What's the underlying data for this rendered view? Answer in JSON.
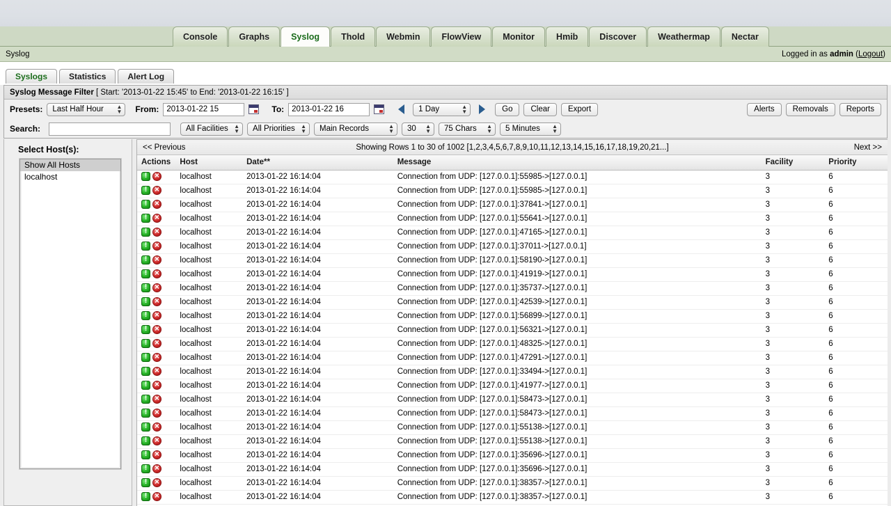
{
  "main_tabs": [
    {
      "label": "Console",
      "active": false
    },
    {
      "label": "Graphs",
      "active": false
    },
    {
      "label": "Syslog",
      "active": true
    },
    {
      "label": "Thold",
      "active": false
    },
    {
      "label": "Webmin",
      "active": false
    },
    {
      "label": "FlowView",
      "active": false
    },
    {
      "label": "Monitor",
      "active": false
    },
    {
      "label": "Hmib",
      "active": false
    },
    {
      "label": "Discover",
      "active": false
    },
    {
      "label": "Weathermap",
      "active": false
    },
    {
      "label": "Nectar",
      "active": false
    }
  ],
  "infobar": {
    "breadcrumb": "Syslog",
    "login_prefix": "Logged in as ",
    "login_user": "admin",
    "logout_open": " (",
    "logout_label": "Logout",
    "logout_close": ")"
  },
  "sub_tabs": [
    {
      "label": "Syslogs",
      "active": true
    },
    {
      "label": "Statistics",
      "active": false
    },
    {
      "label": "Alert Log",
      "active": false
    }
  ],
  "filter": {
    "title": "Syslog Message Filter",
    "range_text": " [ Start: '2013-01-22 15:45' to End: '2013-01-22 16:15' ]",
    "presets_label": "Presets:",
    "presets_value": "Last Half Hour",
    "from_label": "From:",
    "from_value": "2013-01-22 15",
    "to_label": "To:",
    "to_value": "2013-01-22 16",
    "span_value": "1 Day",
    "go_label": "Go",
    "clear_label": "Clear",
    "export_label": "Export",
    "alerts_label": "Alerts",
    "removals_label": "Removals",
    "reports_label": "Reports",
    "search_label": "Search:",
    "search_value": "",
    "search_placeholder": "",
    "facilities_value": "All Facilities",
    "priorities_value": "All Priorities",
    "records_value": "Main Records",
    "rows_value": "30",
    "chars_value": "75 Chars",
    "refresh_value": "5 Minutes"
  },
  "hosts": {
    "title": "Select Host(s):",
    "items": [
      {
        "label": "Show All Hosts",
        "selected": true
      },
      {
        "label": "localhost",
        "selected": false
      }
    ]
  },
  "pager": {
    "previous": "<< Previous",
    "showing": "Showing Rows 1 to 30 of 1002 [",
    "pages": "1,2,3,4,5,6,7,8,9,10,11,12,13,14,15,16,17,18,19,20,21...",
    "showing_close": "]",
    "next": "Next >>"
  },
  "table": {
    "columns": [
      "Actions",
      "Host",
      "Date**",
      "Message",
      "Facility",
      "Priority"
    ],
    "rows": [
      {
        "host": "localhost",
        "date": "2013-01-22 16:14:04",
        "message": "Connection from UDP: [127.0.0.1]:55985->[127.0.0.1]",
        "facility": "3",
        "priority": "6"
      },
      {
        "host": "localhost",
        "date": "2013-01-22 16:14:04",
        "message": "Connection from UDP: [127.0.0.1]:55985->[127.0.0.1]",
        "facility": "3",
        "priority": "6"
      },
      {
        "host": "localhost",
        "date": "2013-01-22 16:14:04",
        "message": "Connection from UDP: [127.0.0.1]:37841->[127.0.0.1]",
        "facility": "3",
        "priority": "6"
      },
      {
        "host": "localhost",
        "date": "2013-01-22 16:14:04",
        "message": "Connection from UDP: [127.0.0.1]:55641->[127.0.0.1]",
        "facility": "3",
        "priority": "6"
      },
      {
        "host": "localhost",
        "date": "2013-01-22 16:14:04",
        "message": "Connection from UDP: [127.0.0.1]:47165->[127.0.0.1]",
        "facility": "3",
        "priority": "6"
      },
      {
        "host": "localhost",
        "date": "2013-01-22 16:14:04",
        "message": "Connection from UDP: [127.0.0.1]:37011->[127.0.0.1]",
        "facility": "3",
        "priority": "6"
      },
      {
        "host": "localhost",
        "date": "2013-01-22 16:14:04",
        "message": "Connection from UDP: [127.0.0.1]:58190->[127.0.0.1]",
        "facility": "3",
        "priority": "6"
      },
      {
        "host": "localhost",
        "date": "2013-01-22 16:14:04",
        "message": "Connection from UDP: [127.0.0.1]:41919->[127.0.0.1]",
        "facility": "3",
        "priority": "6"
      },
      {
        "host": "localhost",
        "date": "2013-01-22 16:14:04",
        "message": "Connection from UDP: [127.0.0.1]:35737->[127.0.0.1]",
        "facility": "3",
        "priority": "6"
      },
      {
        "host": "localhost",
        "date": "2013-01-22 16:14:04",
        "message": "Connection from UDP: [127.0.0.1]:42539->[127.0.0.1]",
        "facility": "3",
        "priority": "6"
      },
      {
        "host": "localhost",
        "date": "2013-01-22 16:14:04",
        "message": "Connection from UDP: [127.0.0.1]:56899->[127.0.0.1]",
        "facility": "3",
        "priority": "6"
      },
      {
        "host": "localhost",
        "date": "2013-01-22 16:14:04",
        "message": "Connection from UDP: [127.0.0.1]:56321->[127.0.0.1]",
        "facility": "3",
        "priority": "6"
      },
      {
        "host": "localhost",
        "date": "2013-01-22 16:14:04",
        "message": "Connection from UDP: [127.0.0.1]:48325->[127.0.0.1]",
        "facility": "3",
        "priority": "6"
      },
      {
        "host": "localhost",
        "date": "2013-01-22 16:14:04",
        "message": "Connection from UDP: [127.0.0.1]:47291->[127.0.0.1]",
        "facility": "3",
        "priority": "6"
      },
      {
        "host": "localhost",
        "date": "2013-01-22 16:14:04",
        "message": "Connection from UDP: [127.0.0.1]:33494->[127.0.0.1]",
        "facility": "3",
        "priority": "6"
      },
      {
        "host": "localhost",
        "date": "2013-01-22 16:14:04",
        "message": "Connection from UDP: [127.0.0.1]:41977->[127.0.0.1]",
        "facility": "3",
        "priority": "6"
      },
      {
        "host": "localhost",
        "date": "2013-01-22 16:14:04",
        "message": "Connection from UDP: [127.0.0.1]:58473->[127.0.0.1]",
        "facility": "3",
        "priority": "6"
      },
      {
        "host": "localhost",
        "date": "2013-01-22 16:14:04",
        "message": "Connection from UDP: [127.0.0.1]:58473->[127.0.0.1]",
        "facility": "3",
        "priority": "6"
      },
      {
        "host": "localhost",
        "date": "2013-01-22 16:14:04",
        "message": "Connection from UDP: [127.0.0.1]:55138->[127.0.0.1]",
        "facility": "3",
        "priority": "6"
      },
      {
        "host": "localhost",
        "date": "2013-01-22 16:14:04",
        "message": "Connection from UDP: [127.0.0.1]:55138->[127.0.0.1]",
        "facility": "3",
        "priority": "6"
      },
      {
        "host": "localhost",
        "date": "2013-01-22 16:14:04",
        "message": "Connection from UDP: [127.0.0.1]:35696->[127.0.0.1]",
        "facility": "3",
        "priority": "6"
      },
      {
        "host": "localhost",
        "date": "2013-01-22 16:14:04",
        "message": "Connection from UDP: [127.0.0.1]:35696->[127.0.0.1]",
        "facility": "3",
        "priority": "6"
      },
      {
        "host": "localhost",
        "date": "2013-01-22 16:14:04",
        "message": "Connection from UDP: [127.0.0.1]:38357->[127.0.0.1]",
        "facility": "3",
        "priority": "6"
      },
      {
        "host": "localhost",
        "date": "2013-01-22 16:14:04",
        "message": "Connection from UDP: [127.0.0.1]:38357->[127.0.0.1]",
        "facility": "3",
        "priority": "6"
      }
    ],
    "action_icons": [
      "info-icon",
      "delete-icon"
    ]
  }
}
